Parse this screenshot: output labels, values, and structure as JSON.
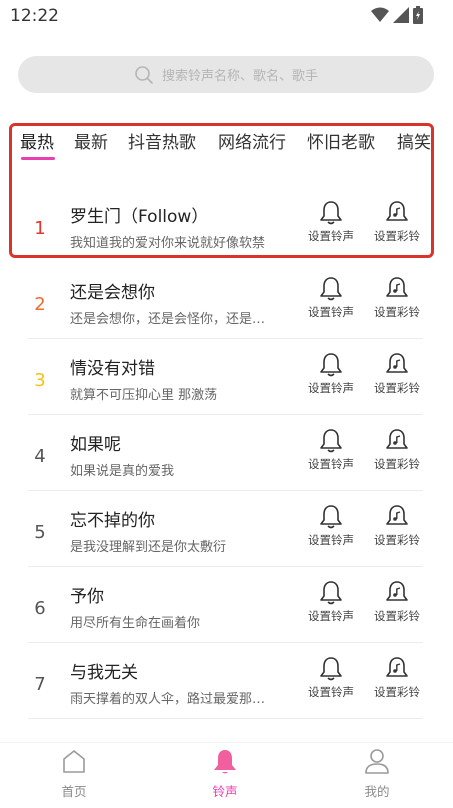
{
  "status_bar": {
    "time": "12:22"
  },
  "search": {
    "placeholder": "搜索铃声名称、歌名、歌手"
  },
  "tabs": [
    {
      "label": "最热",
      "active": true
    },
    {
      "label": "最新"
    },
    {
      "label": "抖音热歌"
    },
    {
      "label": "网络流行"
    },
    {
      "label": "怀旧老歌"
    },
    {
      "label": "搞笑"
    }
  ],
  "actions": {
    "ringtone": "设置铃声",
    "crbt": "设置彩铃"
  },
  "songs": [
    {
      "rank": "1",
      "title": "罗生门（Follow）",
      "lyric": "我知道我的爱对你来说就好像软禁",
      "rank_color": "#e5342b"
    },
    {
      "rank": "2",
      "title": "还是会想你",
      "lyric": "还是会想你，还是会怪你，还是…",
      "rank_color": "#f46a2a"
    },
    {
      "rank": "3",
      "title": "情没有对错",
      "lyric": "就算不可压抑心里 那激荡",
      "rank_color": "#f5c11a"
    },
    {
      "rank": "4",
      "title": "如果呢",
      "lyric": "如果说是真的爱我",
      "rank_color": "#555555"
    },
    {
      "rank": "5",
      "title": "忘不掉的你",
      "lyric": "是我没理解到还是你太敷衍",
      "rank_color": "#555555"
    },
    {
      "rank": "6",
      "title": "予你",
      "lyric": "用尽所有生命在画着你",
      "rank_color": "#555555"
    },
    {
      "rank": "7",
      "title": "与我无关",
      "lyric": "雨天撑着的双人伞，路过最爱那…",
      "rank_color": "#555555"
    }
  ],
  "bottom_nav": [
    {
      "label": "首页",
      "icon": "home-icon"
    },
    {
      "label": "铃声",
      "icon": "bell-icon",
      "active": true
    },
    {
      "label": "我的",
      "icon": "user-icon"
    }
  ],
  "colors": {
    "accent": "#e83fb2",
    "highlight": "#d9342a"
  }
}
